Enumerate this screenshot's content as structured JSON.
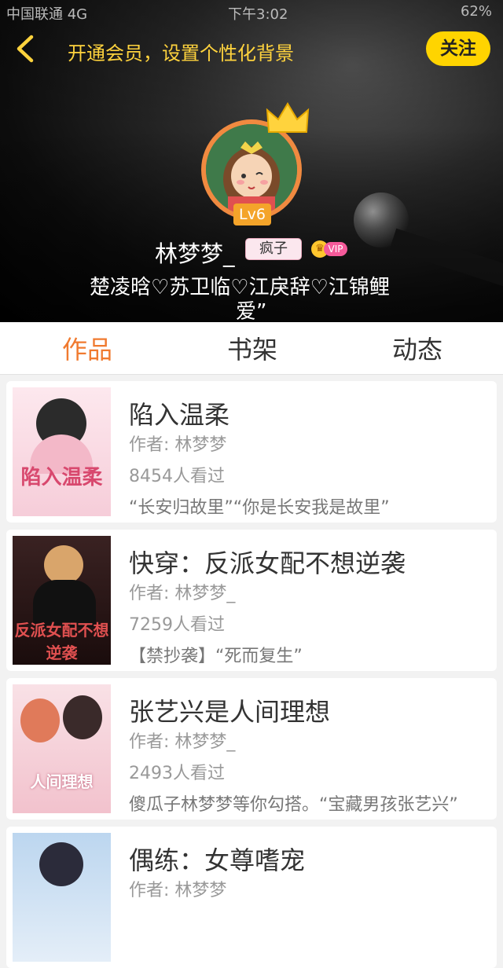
{
  "status_bar": {
    "left": "中国联通 4G",
    "center": "下午3:02",
    "right": "62%"
  },
  "header": {
    "vip_tip": "开通会员，设置个性化背景",
    "follow_label": "关注",
    "level": "Lv6",
    "username": "林梦梦_",
    "badge": "疯子",
    "vip_label": "VIP",
    "signature_line1": "楚凌晗♡苏卫临♡江戾辞♡江锦鲤",
    "signature_line2": "爱”"
  },
  "tabs": [
    {
      "label": "作品",
      "active": true
    },
    {
      "label": "书架",
      "active": false
    },
    {
      "label": "动态",
      "active": false
    }
  ],
  "works": [
    {
      "title": "陷入温柔",
      "author": "作者: 林梦梦",
      "views": "8454人看过",
      "desc": "“长安归故里”“你是长安我是故里”",
      "cover_text": "陷入温柔"
    },
    {
      "title": "快穿：反派女配不想逆袭",
      "author": "作者: 林梦梦_",
      "views": "7259人看过",
      "desc": "【禁抄袭】“死而复生”",
      "cover_text": "反派女配不想逆袭"
    },
    {
      "title": "张艺兴是人间理想",
      "author": "作者: 林梦梦_",
      "views": "2493人看过",
      "desc": "傻瓜子林梦梦等你勾搭。“宝藏男孩张艺兴”",
      "cover_text": "人间理想"
    },
    {
      "title": "偶练：女尊嗜宠",
      "author": "作者: 林梦梦",
      "views": "",
      "desc": "",
      "cover_text": ""
    }
  ],
  "colors": {
    "accent": "#f07a2f",
    "follow_bg": "#ffd400",
    "vip_tip": "#ffd33d"
  }
}
